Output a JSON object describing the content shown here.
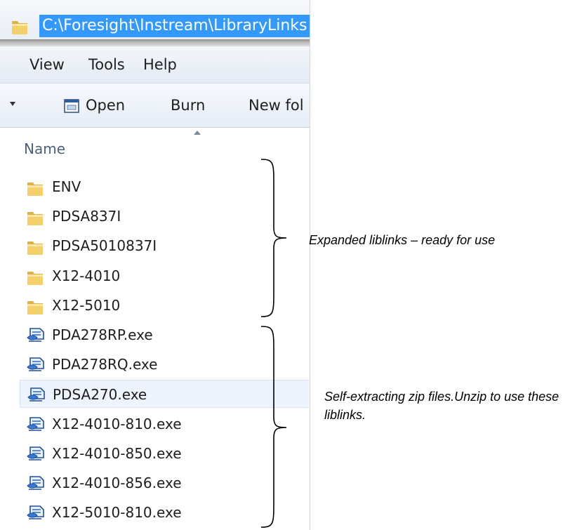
{
  "address_bar": {
    "path": "C:\\Foresight\\Instream\\LibraryLinks"
  },
  "menu": {
    "items": [
      "View",
      "Tools",
      "Help"
    ]
  },
  "toolbar": {
    "open_label": "Open",
    "burn_label": "Burn",
    "new_folder_label": "New fol"
  },
  "file_list": {
    "column_header": "Name",
    "items": [
      {
        "name": "ENV",
        "type": "folder"
      },
      {
        "name": "PDSA837I",
        "type": "folder"
      },
      {
        "name": "PDSA5010837I",
        "type": "folder"
      },
      {
        "name": "X12-4010",
        "type": "folder"
      },
      {
        "name": "X12-5010",
        "type": "folder"
      },
      {
        "name": "PDA278RP.exe",
        "type": "exe"
      },
      {
        "name": "PDA278RQ.exe",
        "type": "exe"
      },
      {
        "name": "PDSA270.exe",
        "type": "exe",
        "selected": true
      },
      {
        "name": "X12-4010-810.exe",
        "type": "exe"
      },
      {
        "name": "X12-4010-850.exe",
        "type": "exe"
      },
      {
        "name": "X12-4010-856.exe",
        "type": "exe"
      },
      {
        "name": "X12-5010-810.exe",
        "type": "exe"
      }
    ]
  },
  "annotations": {
    "expanded": "Expanded liblinks – ready for use",
    "zips": "Self-extracting zip files.Unzip to use these liblinks."
  },
  "icons": {
    "folder": "folder-icon",
    "exe": "self-extracting-exe-icon",
    "open": "open-window-icon"
  },
  "colors": {
    "selection": "#3399ff",
    "row_selected": "#eef4fd",
    "header_text": "#4c607a"
  }
}
